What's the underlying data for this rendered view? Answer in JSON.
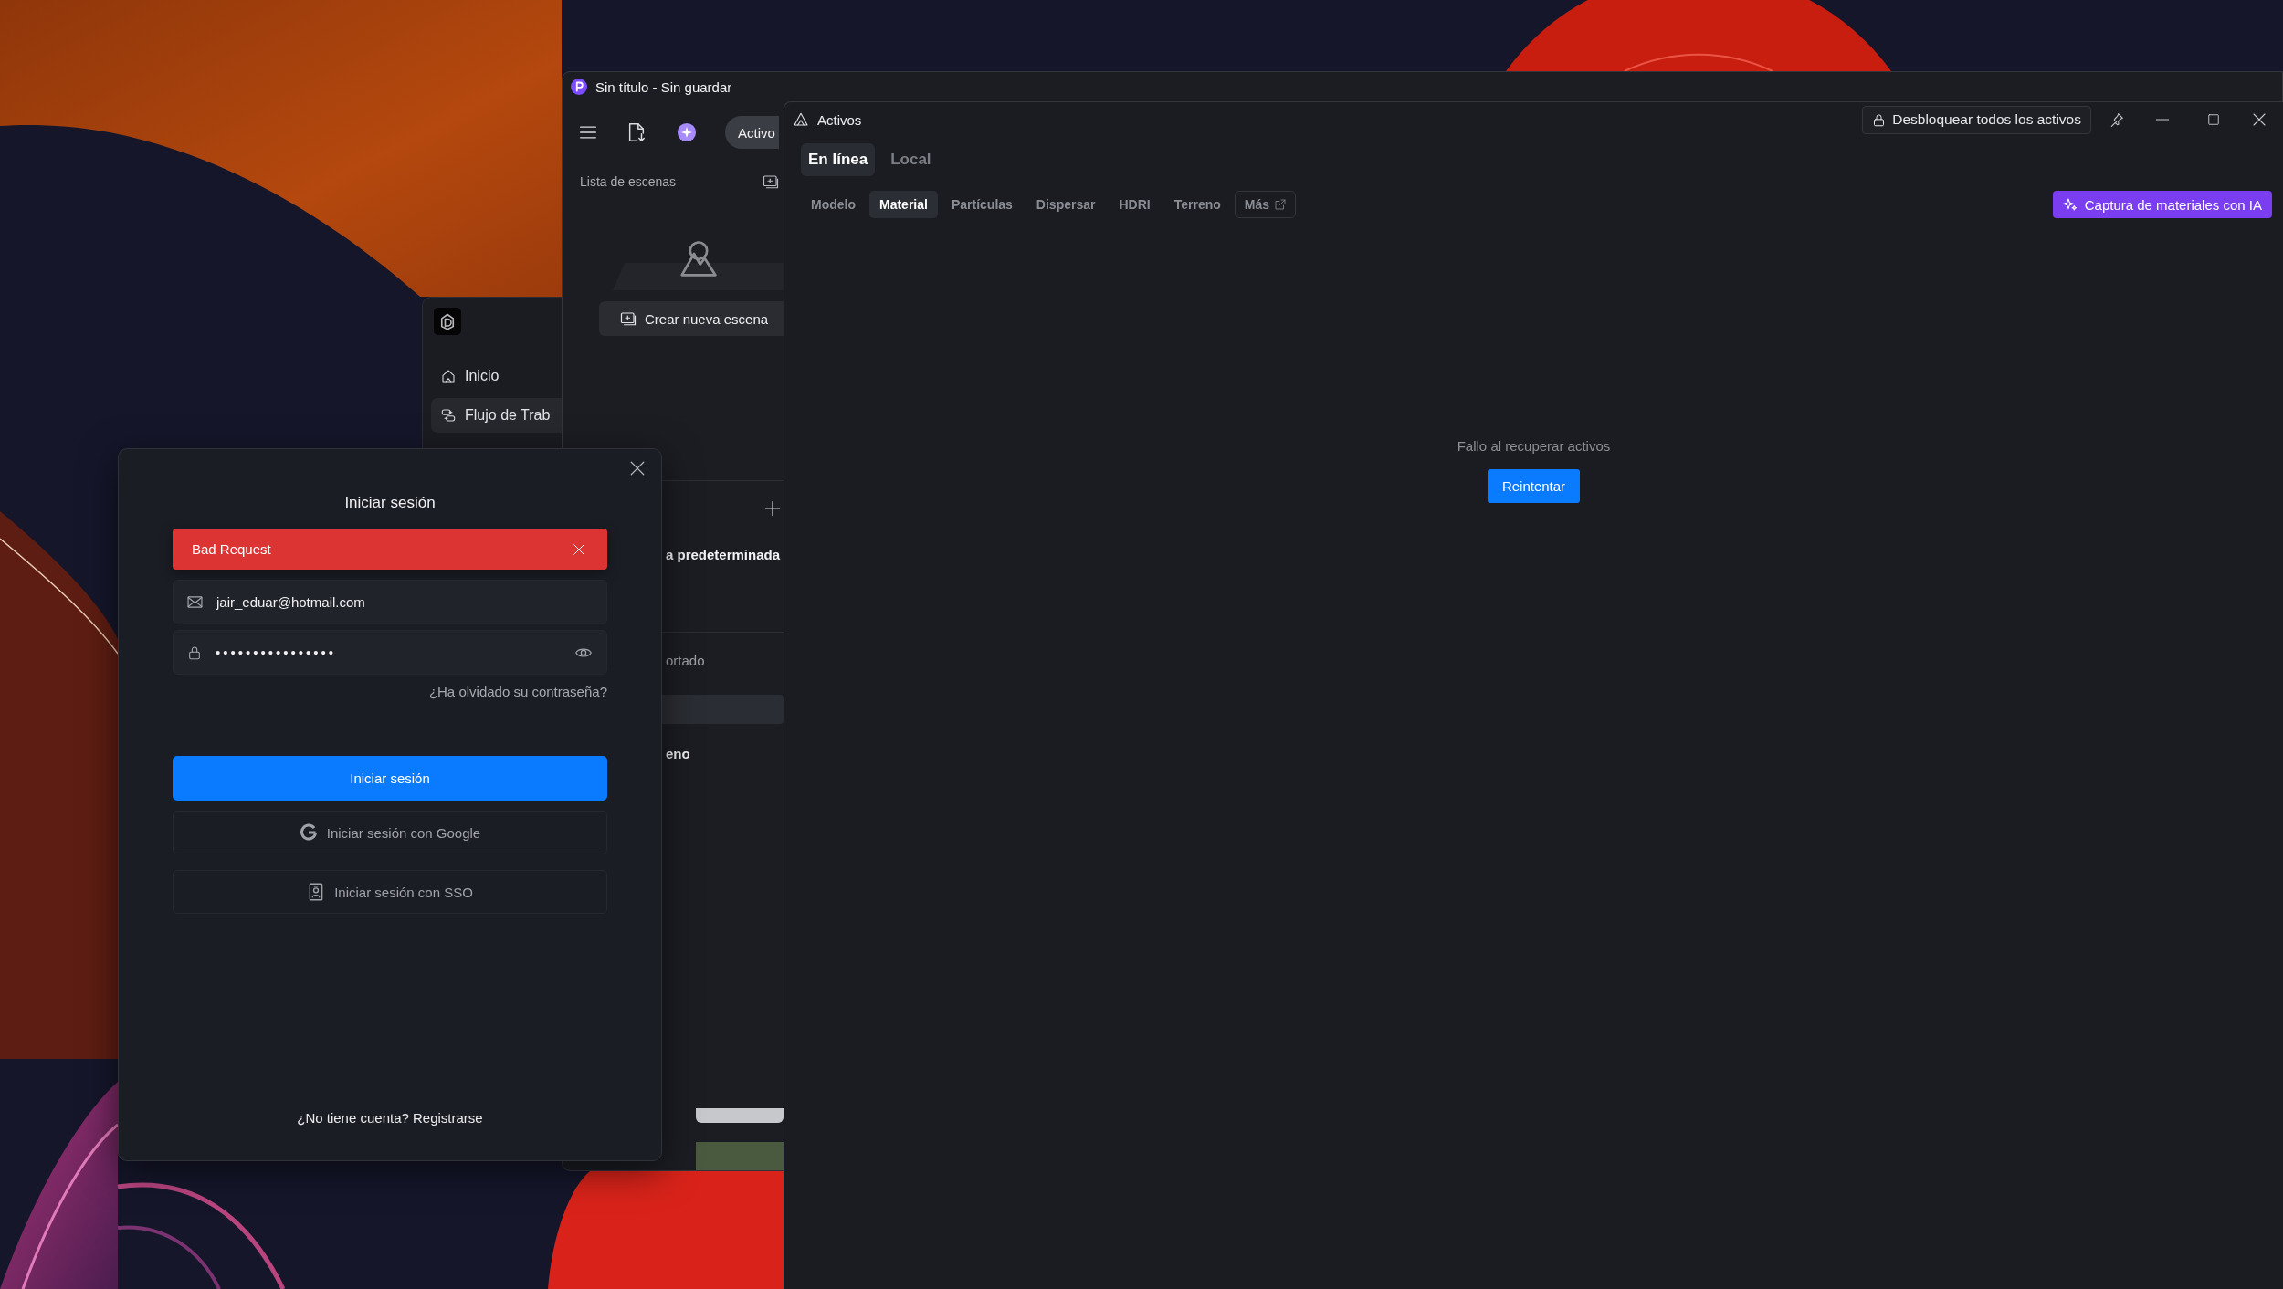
{
  "workflow_window": {
    "items": [
      {
        "label": "Inicio",
        "selected": false
      },
      {
        "label": "Flujo de Trab",
        "selected": true
      }
    ]
  },
  "editor_window": {
    "title": "Sin título - Sin guardar",
    "toolbar_tab": "Activo",
    "scene_list": {
      "title": "Lista de escenas",
      "create_button": "Crear nueva escena"
    },
    "layers": {
      "label": "a predeterminada"
    },
    "imports": {
      "title": "ortado",
      "rows": [
        {
          "selected": true
        },
        {
          "label": "eno",
          "selected": false
        }
      ]
    }
  },
  "assets_window": {
    "title": "Activos",
    "unlock_button": "Desbloquear todos los activos",
    "source_tabs": [
      {
        "label": "En línea",
        "selected": true
      },
      {
        "label": "Local",
        "selected": false
      }
    ],
    "category_tabs": [
      {
        "label": "Modelo",
        "selected": false,
        "kind": "tab"
      },
      {
        "label": "Material",
        "selected": true,
        "kind": "tab"
      },
      {
        "label": "Partículas",
        "selected": false,
        "kind": "tab"
      },
      {
        "label": "Dispersar",
        "selected": false,
        "kind": "tab"
      },
      {
        "label": "HDRI",
        "selected": false,
        "kind": "tab"
      },
      {
        "label": "Terreno",
        "selected": false,
        "kind": "tab"
      },
      {
        "label": "Más",
        "selected": false,
        "kind": "external"
      }
    ],
    "ai_button": "Captura de materiales con IA",
    "error_message": "Fallo al recuperar activos",
    "retry_button": "Reintentar"
  },
  "login_dialog": {
    "title": "Iniciar sesión",
    "alert": "Bad Request",
    "email": {
      "value": "jair_eduar@hotmail.com"
    },
    "password": {
      "value": "••••••••••••••••"
    },
    "forgot_link": "¿Ha olvidado su contraseña?",
    "submit_button": "Iniciar sesión",
    "google_button": "Iniciar sesión con Google",
    "sso_button": "Iniciar sesión con SSO",
    "signup": {
      "prompt": "¿No tiene cuenta?",
      "link": "Registrarse"
    }
  }
}
